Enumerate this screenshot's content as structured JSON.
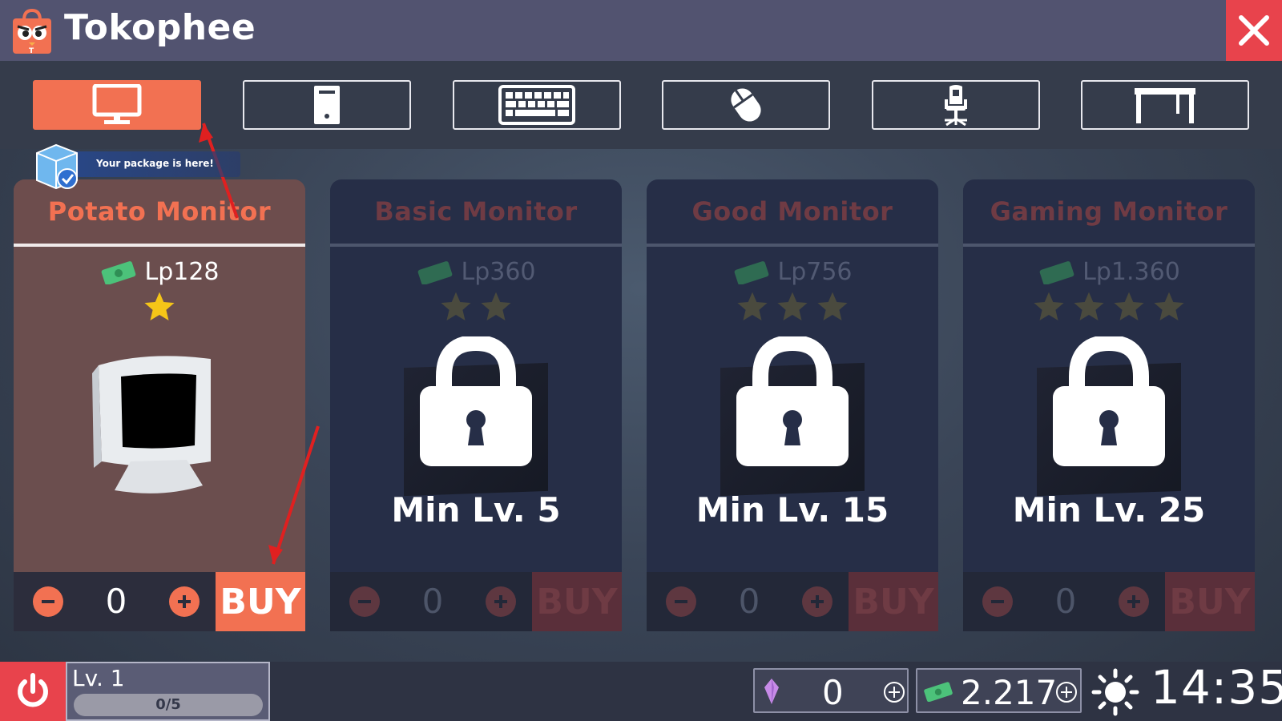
{
  "app": {
    "title": "Tokophee",
    "close_icon": "close-icon"
  },
  "tabs": [
    {
      "icon": "monitor-icon",
      "active": true
    },
    {
      "icon": "pc-case-icon",
      "active": false
    },
    {
      "icon": "keyboard-icon",
      "active": false
    },
    {
      "icon": "mouse-icon",
      "active": false
    },
    {
      "icon": "gaming-chair-icon",
      "active": false
    },
    {
      "icon": "desk-icon",
      "active": false
    }
  ],
  "notification": {
    "text": "Your package is here!",
    "icon": "package-delivered-icon"
  },
  "products": [
    {
      "name": "Potato Monitor",
      "price": "Lp128",
      "stars": 1,
      "locked": false,
      "quantity": "0",
      "buy_label": "BUY"
    },
    {
      "name": "Basic Monitor",
      "price": "Lp360",
      "stars": 2,
      "locked": true,
      "min_level": "Min Lv. 5",
      "quantity": "0",
      "buy_label": "BUY"
    },
    {
      "name": "Good Monitor",
      "price": "Lp756",
      "stars": 3,
      "locked": true,
      "min_level": "Min Lv. 15",
      "quantity": "0",
      "buy_label": "BUY"
    },
    {
      "name": "Gaming Monitor",
      "price": "Lp1.360",
      "stars": 4,
      "locked": true,
      "min_level": "Min Lv. 25",
      "quantity": "0",
      "buy_label": "BUY"
    }
  ],
  "status": {
    "level_label": "Lv. 1",
    "xp_text": "0/5",
    "xp_progress": 0,
    "gems": "0",
    "cash": "2.217",
    "time": "14:35",
    "weather_icon": "sun-icon"
  },
  "colors": {
    "accent": "#f27152",
    "close_red": "#e8434c",
    "titlebar": "#525370",
    "star_gold": "#f5c518"
  }
}
